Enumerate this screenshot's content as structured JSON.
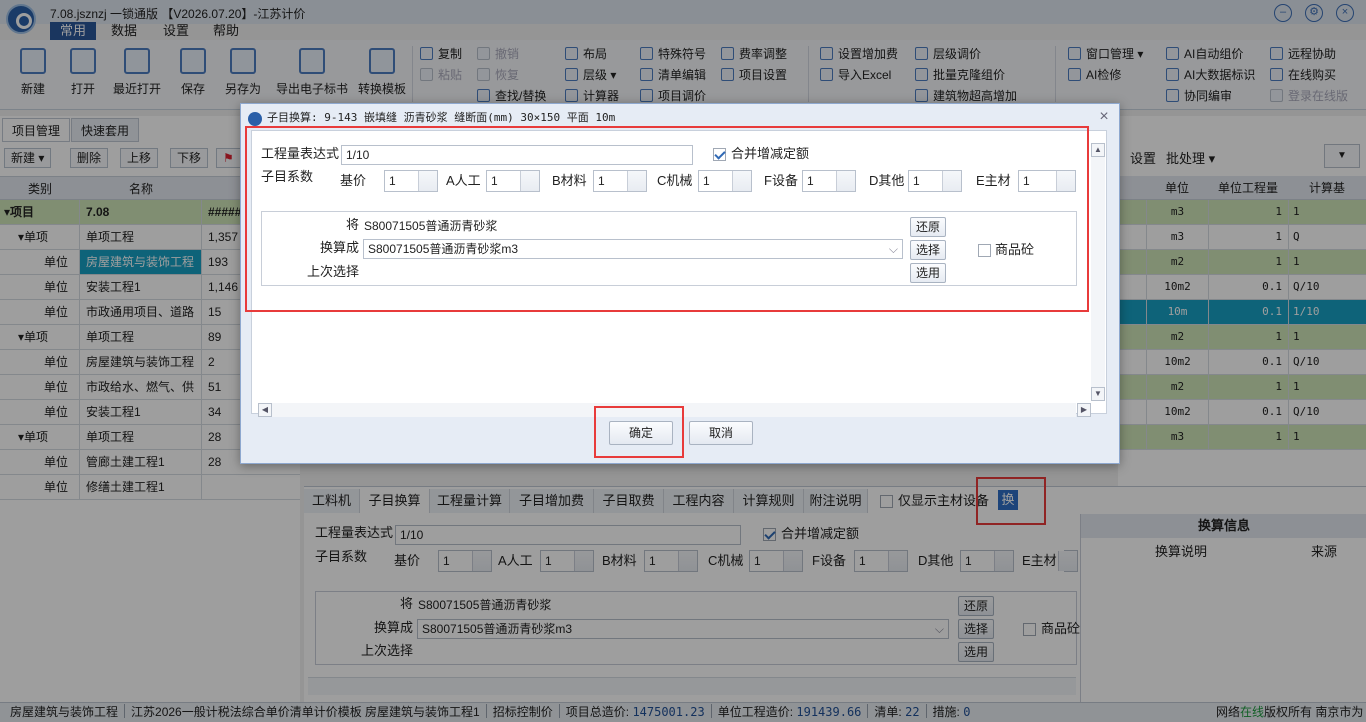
{
  "title_bar": {
    "app_title": "7.08.jsznzj 一锁通版 【V2026.07.20】-江苏计价"
  },
  "menu_tabs": [
    "常用",
    "数据",
    "设置",
    "帮助"
  ],
  "ribbon": {
    "big": [
      "新建",
      "打开",
      "最近打开",
      "保存",
      "另存为",
      "导出电子标书",
      "转换模板"
    ],
    "col1": [
      "复制",
      "粘贴"
    ],
    "col2": [
      "撤销",
      "恢复",
      "查找/替换"
    ],
    "col3": [
      "布局",
      "层级",
      "计算器"
    ],
    "col4": [
      "特殊符号",
      "清单编辑",
      "项目调价"
    ],
    "col5": [
      "费率调整",
      "项目设置"
    ],
    "col6": [
      "设置增加费",
      "导入Excel"
    ],
    "col7": [
      "层级调价",
      "批量克隆组价",
      "建筑物超高增加"
    ],
    "col8": [
      "窗口管理",
      "AI检修"
    ],
    "col9": [
      "AI自动组价",
      "AI大数据标识",
      "协同编审"
    ],
    "col10": [
      "远程协助",
      "在线购买",
      "登录在线版"
    ]
  },
  "left_panel": {
    "tabs": [
      "项目管理",
      "快速套用"
    ],
    "toolbar": [
      "新建",
      "删除",
      "上移",
      "下移"
    ],
    "headers": [
      "类别",
      "名称",
      "金"
    ],
    "rows": [
      {
        "type": "▾项目",
        "name": "7.08",
        "amount": "#####"
      },
      {
        "type": "▾单项",
        "name": "单项工程",
        "amount": "1,357"
      },
      {
        "type": "单位",
        "name": "房屋建筑与装饰工程",
        "amount": "193"
      },
      {
        "type": "单位",
        "name": "安装工程1",
        "amount": "1,146"
      },
      {
        "type": "单位",
        "name": "市政通用项目、道路",
        "amount": "15"
      },
      {
        "type": "▾单项",
        "name": "单项工程",
        "amount": "89"
      },
      {
        "type": "单位",
        "name": "房屋建筑与装饰工程",
        "amount": "2"
      },
      {
        "type": "单位",
        "name": "市政给水、燃气、供",
        "amount": "51"
      },
      {
        "type": "单位",
        "name": "安装工程1",
        "amount": "34"
      },
      {
        "type": "▾单项",
        "name": "单项工程",
        "amount": "28"
      },
      {
        "type": "单位",
        "name": "管廊土建工程1",
        "amount": "28"
      },
      {
        "type": "单位",
        "name": "修缮土建工程1",
        "amount": ""
      }
    ]
  },
  "right_grid": {
    "toolbar": [
      "设置",
      "批处理"
    ],
    "headers": [
      "单位",
      "单位工程量",
      "计算基"
    ],
    "rows": [
      {
        "unit": "m3",
        "qty": "1",
        "base": "1"
      },
      {
        "unit": "m3",
        "qty": "1",
        "base": "Q"
      },
      {
        "unit": "m2",
        "qty": "1",
        "base": "1"
      },
      {
        "unit": "10m2",
        "qty": "0.1",
        "base": "Q/10"
      },
      {
        "unit": "10m",
        "qty": "0.1",
        "base": "1/10"
      },
      {
        "unit": "m2",
        "qty": "1",
        "base": "1"
      },
      {
        "unit": "10m2",
        "qty": "0.1",
        "base": "Q/10"
      },
      {
        "unit": "m2",
        "qty": "1",
        "base": "1"
      },
      {
        "unit": "10m2",
        "qty": "0.1",
        "base": "Q/10"
      },
      {
        "unit": "m3",
        "qty": "1",
        "base": "1"
      }
    ]
  },
  "bottom_pane": {
    "tabs": [
      "工料机",
      "子目换算",
      "工程量计算",
      "子目增加费",
      "子目取费",
      "工程内容",
      "计算规则",
      "附注说明"
    ],
    "only_main_material": "仅显示主材设备",
    "huan_button": "换",
    "expression_label": "工程量表达式",
    "expression_value": "1/10",
    "merge_label": "合并增减定额",
    "coef_label": "子目系数",
    "coef_labels": [
      "基价",
      "A人工",
      "B材料",
      "C机械",
      "F设备",
      "D其他",
      "E主材"
    ],
    "coef_values": [
      "1",
      "1",
      "1",
      "1",
      "1",
      "1",
      "1"
    ],
    "jiang_label": "将",
    "jiang_value": "S80071505普通沥青砂浆",
    "huancheng_label": "换算成",
    "huancheng_value": "S80071505普通沥青砂浆m3",
    "last_label": "上次选择",
    "restore": "还原",
    "select": "选择",
    "apply": "选用",
    "commercial_concrete": "商品砼"
  },
  "info_pane": {
    "title": "换算信息",
    "col1": "换算说明",
    "col2": "来源"
  },
  "status_bar": {
    "items": [
      "房屋建筑与装饰工程",
      "江苏2026一般计税法综合单价清单计价模板 房屋建筑与装饰工程1",
      "招标控制价"
    ],
    "total_label": "项目总造价:",
    "total_value": "1475001.23",
    "unit_label": "单位工程造价:",
    "unit_value": "191439.66",
    "list_label": "清单:",
    "list_value": "22",
    "measure_label": "措施:",
    "measure_value": "0",
    "network": "网络",
    "online": "在线",
    "copyright": "版权所有 南京市为"
  },
  "dialog": {
    "title": "子目换算: 9-143 嵌填缝 沥青砂浆 缝断面(mm) 30×150 平面 10m",
    "expression_label": "工程量表达式",
    "expression_value": "1/10",
    "merge_label": "合并增减定额",
    "coef_label": "子目系数",
    "coef_labels": [
      "基价",
      "A人工",
      "B材料",
      "C机械",
      "F设备",
      "D其他",
      "E主材"
    ],
    "coef_values": [
      "1",
      "1",
      "1",
      "1",
      "1",
      "1",
      "1"
    ],
    "jiang_label": "将",
    "jiang_value": "S80071505普通沥青砂浆",
    "huancheng_label": "换算成",
    "huancheng_value": "S80071505普通沥青砂浆m3",
    "last_label": "上次选择",
    "restore": "还原",
    "select": "选择",
    "apply": "选用",
    "commercial_concrete": "商品砼",
    "ok": "确定",
    "cancel": "取消"
  }
}
